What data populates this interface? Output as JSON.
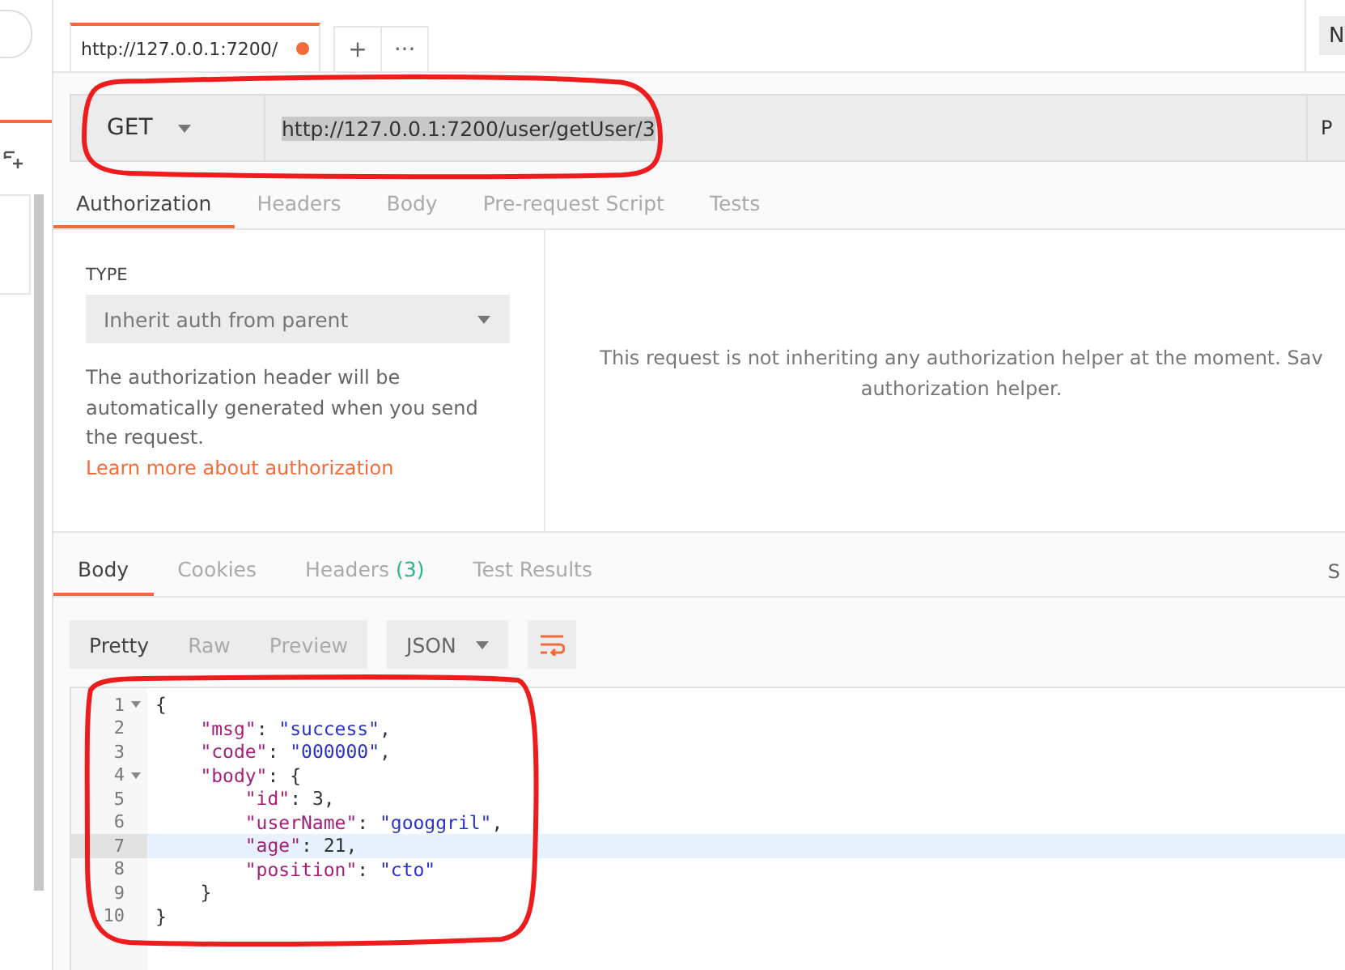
{
  "sidebar": {
    "items": [
      {
        "kind": "search"
      },
      {
        "kind": "add"
      }
    ]
  },
  "request_tabs": [
    {
      "label": "http://127.0.0.1:7200/",
      "selected": true,
      "unsaved": true
    }
  ],
  "tab_actions": [
    "+",
    "···"
  ],
  "environment": {
    "label": "N"
  },
  "url_bar": {
    "method": "GET",
    "url": "http://127.0.0.1:7200/user/getUser/3",
    "url_selected": true,
    "params_label": "P"
  },
  "request_sections": [
    {
      "label": "Authorization",
      "selected": true
    },
    {
      "label": "Headers",
      "selected": false
    },
    {
      "label": "Body",
      "selected": false
    },
    {
      "label": "Pre-request Script",
      "selected": false
    },
    {
      "label": "Tests",
      "selected": false
    }
  ],
  "auth": {
    "type_label": "TYPE",
    "type_value": "Inherit auth from parent",
    "description": "The authorization header will be automatically generated when you send the request.",
    "link": "Learn more about authorization",
    "message": [
      "This request is not inheriting any authorization helper at the moment. Sav",
      "authorization helper."
    ]
  },
  "response_tabs": [
    {
      "label": "Body",
      "selected": true
    },
    {
      "label": "Cookies",
      "selected": false
    },
    {
      "label": "Headers",
      "count": "(3)",
      "selected": false
    },
    {
      "label": "Test Results",
      "selected": false
    }
  ],
  "response_status": "S",
  "view_modes": [
    {
      "label": "Pretty",
      "selected": true
    },
    {
      "label": "Raw",
      "selected": false
    },
    {
      "label": "Preview",
      "selected": false
    }
  ],
  "format": "JSON",
  "code_lines": [
    {
      "number": "1",
      "fold": true,
      "selected": false,
      "tokens": [
        {
          "kind": "punct",
          "text": "{"
        }
      ]
    },
    {
      "number": "2",
      "fold": false,
      "selected": false,
      "tokens": [
        {
          "kind": "key",
          "text": "    \"msg\""
        },
        {
          "kind": "punct",
          "text": ": "
        },
        {
          "kind": "string",
          "text": "\"success\""
        },
        {
          "kind": "punct",
          "text": ","
        }
      ]
    },
    {
      "number": "3",
      "fold": false,
      "selected": false,
      "tokens": [
        {
          "kind": "key",
          "text": "    \"code\""
        },
        {
          "kind": "punct",
          "text": ": "
        },
        {
          "kind": "string",
          "text": "\"000000\""
        },
        {
          "kind": "punct",
          "text": ","
        }
      ]
    },
    {
      "number": "4",
      "fold": true,
      "selected": false,
      "tokens": [
        {
          "kind": "key",
          "text": "    \"body\""
        },
        {
          "kind": "punct",
          "text": ": {"
        }
      ]
    },
    {
      "number": "5",
      "fold": false,
      "selected": false,
      "tokens": [
        {
          "kind": "key",
          "text": "        \"id\""
        },
        {
          "kind": "punct",
          "text": ": "
        },
        {
          "kind": "number",
          "text": "3"
        },
        {
          "kind": "punct",
          "text": ","
        }
      ]
    },
    {
      "number": "6",
      "fold": false,
      "selected": false,
      "tokens": [
        {
          "kind": "key",
          "text": "        \"userName\""
        },
        {
          "kind": "punct",
          "text": ": "
        },
        {
          "kind": "string",
          "text": "\"googgril\""
        },
        {
          "kind": "punct",
          "text": ","
        }
      ]
    },
    {
      "number": "7",
      "fold": false,
      "selected": true,
      "tokens": [
        {
          "kind": "key",
          "text": "        \"age\""
        },
        {
          "kind": "punct",
          "text": ": "
        },
        {
          "kind": "number",
          "text": "21"
        },
        {
          "kind": "punct",
          "text": ","
        }
      ]
    },
    {
      "number": "8",
      "fold": false,
      "selected": false,
      "tokens": [
        {
          "kind": "key",
          "text": "        \"position\""
        },
        {
          "kind": "punct",
          "text": ": "
        },
        {
          "kind": "string",
          "text": "\"cto\""
        }
      ]
    },
    {
      "number": "9",
      "fold": false,
      "selected": false,
      "tokens": [
        {
          "kind": "punct",
          "text": "    }"
        }
      ]
    },
    {
      "number": "10",
      "fold": false,
      "selected": false,
      "tokens": [
        {
          "kind": "punct",
          "text": "}"
        }
      ]
    }
  ],
  "annotations": [
    {
      "kind": "freehand-circle"
    },
    {
      "kind": "freehand-circle"
    }
  ]
}
